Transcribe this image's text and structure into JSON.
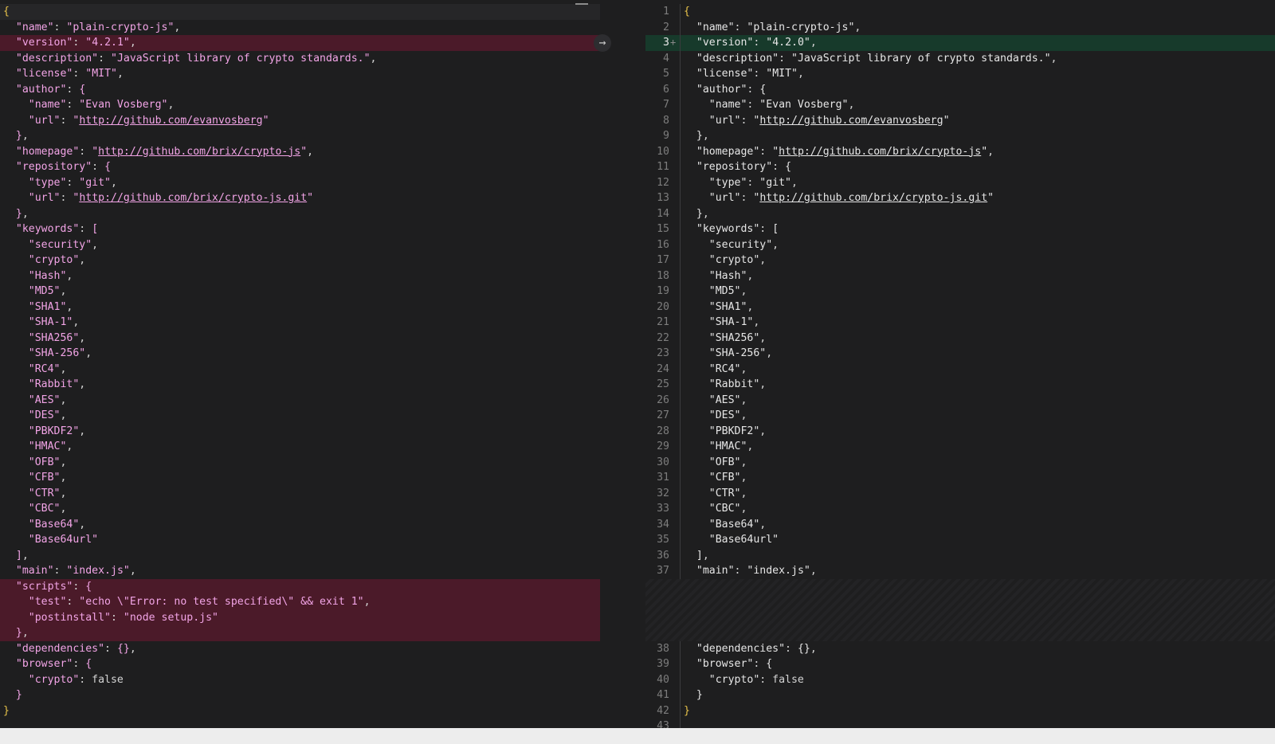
{
  "diff": {
    "left": [
      {
        "text": "{",
        "kind": "first"
      },
      {
        "text": "  \"name\": \"plain-crypto-js\",",
        "kind": "normal"
      },
      {
        "text": "  \"version\": \"4.2.1\",",
        "kind": "removed"
      },
      {
        "text": "  \"description\": \"JavaScript library of crypto standards.\",",
        "kind": "normal"
      },
      {
        "text": "  \"license\": \"MIT\",",
        "kind": "normal"
      },
      {
        "text": "  \"author\": {",
        "kind": "normal"
      },
      {
        "text": "    \"name\": \"Evan Vosberg\",",
        "kind": "normal"
      },
      {
        "text": "    \"url\": \"http://github.com/evanvosberg\"",
        "kind": "normal"
      },
      {
        "text": "  },",
        "kind": "normal"
      },
      {
        "text": "  \"homepage\": \"http://github.com/brix/crypto-js\",",
        "kind": "normal"
      },
      {
        "text": "  \"repository\": {",
        "kind": "normal"
      },
      {
        "text": "    \"type\": \"git\",",
        "kind": "normal"
      },
      {
        "text": "    \"url\": \"http://github.com/brix/crypto-js.git\"",
        "kind": "normal"
      },
      {
        "text": "  },",
        "kind": "normal"
      },
      {
        "text": "  \"keywords\": [",
        "kind": "normal"
      },
      {
        "text": "    \"security\",",
        "kind": "normal"
      },
      {
        "text": "    \"crypto\",",
        "kind": "normal"
      },
      {
        "text": "    \"Hash\",",
        "kind": "normal"
      },
      {
        "text": "    \"MD5\",",
        "kind": "normal"
      },
      {
        "text": "    \"SHA1\",",
        "kind": "normal"
      },
      {
        "text": "    \"SHA-1\",",
        "kind": "normal"
      },
      {
        "text": "    \"SHA256\",",
        "kind": "normal"
      },
      {
        "text": "    \"SHA-256\",",
        "kind": "normal"
      },
      {
        "text": "    \"RC4\",",
        "kind": "normal"
      },
      {
        "text": "    \"Rabbit\",",
        "kind": "normal"
      },
      {
        "text": "    \"AES\",",
        "kind": "normal"
      },
      {
        "text": "    \"DES\",",
        "kind": "normal"
      },
      {
        "text": "    \"PBKDF2\",",
        "kind": "normal"
      },
      {
        "text": "    \"HMAC\",",
        "kind": "normal"
      },
      {
        "text": "    \"OFB\",",
        "kind": "normal"
      },
      {
        "text": "    \"CFB\",",
        "kind": "normal"
      },
      {
        "text": "    \"CTR\",",
        "kind": "normal"
      },
      {
        "text": "    \"CBC\",",
        "kind": "normal"
      },
      {
        "text": "    \"Base64\",",
        "kind": "normal"
      },
      {
        "text": "    \"Base64url\"",
        "kind": "normal"
      },
      {
        "text": "  ],",
        "kind": "normal"
      },
      {
        "text": "  \"main\": \"index.js\",",
        "kind": "normal"
      },
      {
        "text": "  \"scripts\": {",
        "kind": "removed"
      },
      {
        "text": "    \"test\": \"echo \\\"Error: no test specified\\\" && exit 1\",",
        "kind": "removed"
      },
      {
        "text": "    \"postinstall\": \"node setup.js\"",
        "kind": "removed"
      },
      {
        "text": "  },",
        "kind": "removed"
      },
      {
        "text": "  \"dependencies\": {},",
        "kind": "normal"
      },
      {
        "text": "  \"browser\": {",
        "kind": "normal"
      },
      {
        "text": "    \"crypto\": false",
        "kind": "normal"
      },
      {
        "text": "  }",
        "kind": "normal"
      },
      {
        "text": "}",
        "kind": "normal"
      }
    ],
    "right": [
      {
        "ln": "1",
        "text": "{",
        "kind": "normal"
      },
      {
        "ln": "2",
        "text": "  \"name\": \"plain-crypto-js\",",
        "kind": "normal"
      },
      {
        "ln": "3",
        "text": "  \"version\": \"4.2.0\",",
        "kind": "added",
        "marker": "+"
      },
      {
        "ln": "4",
        "text": "  \"description\": \"JavaScript library of crypto standards.\",",
        "kind": "normal"
      },
      {
        "ln": "5",
        "text": "  \"license\": \"MIT\",",
        "kind": "normal"
      },
      {
        "ln": "6",
        "text": "  \"author\": {",
        "kind": "normal"
      },
      {
        "ln": "7",
        "text": "    \"name\": \"Evan Vosberg\",",
        "kind": "normal"
      },
      {
        "ln": "8",
        "text": "    \"url\": \"http://github.com/evanvosberg\"",
        "kind": "normal"
      },
      {
        "ln": "9",
        "text": "  },",
        "kind": "normal"
      },
      {
        "ln": "10",
        "text": "  \"homepage\": \"http://github.com/brix/crypto-js\",",
        "kind": "normal"
      },
      {
        "ln": "11",
        "text": "  \"repository\": {",
        "kind": "normal"
      },
      {
        "ln": "12",
        "text": "    \"type\": \"git\",",
        "kind": "normal"
      },
      {
        "ln": "13",
        "text": "    \"url\": \"http://github.com/brix/crypto-js.git\"",
        "kind": "normal"
      },
      {
        "ln": "14",
        "text": "  },",
        "kind": "normal"
      },
      {
        "ln": "15",
        "text": "  \"keywords\": [",
        "kind": "normal"
      },
      {
        "ln": "16",
        "text": "    \"security\",",
        "kind": "normal"
      },
      {
        "ln": "17",
        "text": "    \"crypto\",",
        "kind": "normal"
      },
      {
        "ln": "18",
        "text": "    \"Hash\",",
        "kind": "normal"
      },
      {
        "ln": "19",
        "text": "    \"MD5\",",
        "kind": "normal"
      },
      {
        "ln": "20",
        "text": "    \"SHA1\",",
        "kind": "normal"
      },
      {
        "ln": "21",
        "text": "    \"SHA-1\",",
        "kind": "normal"
      },
      {
        "ln": "22",
        "text": "    \"SHA256\",",
        "kind": "normal"
      },
      {
        "ln": "23",
        "text": "    \"SHA-256\",",
        "kind": "normal"
      },
      {
        "ln": "24",
        "text": "    \"RC4\",",
        "kind": "normal"
      },
      {
        "ln": "25",
        "text": "    \"Rabbit\",",
        "kind": "normal"
      },
      {
        "ln": "26",
        "text": "    \"AES\",",
        "kind": "normal"
      },
      {
        "ln": "27",
        "text": "    \"DES\",",
        "kind": "normal"
      },
      {
        "ln": "28",
        "text": "    \"PBKDF2\",",
        "kind": "normal"
      },
      {
        "ln": "29",
        "text": "    \"HMAC\",",
        "kind": "normal"
      },
      {
        "ln": "30",
        "text": "    \"OFB\",",
        "kind": "normal"
      },
      {
        "ln": "31",
        "text": "    \"CFB\",",
        "kind": "normal"
      },
      {
        "ln": "32",
        "text": "    \"CTR\",",
        "kind": "normal"
      },
      {
        "ln": "33",
        "text": "    \"CBC\",",
        "kind": "normal"
      },
      {
        "ln": "34",
        "text": "    \"Base64\",",
        "kind": "normal"
      },
      {
        "ln": "35",
        "text": "    \"Base64url\"",
        "kind": "normal"
      },
      {
        "ln": "36",
        "text": "  ],",
        "kind": "normal"
      },
      {
        "ln": "37",
        "text": "  \"main\": \"index.js\",",
        "kind": "normal"
      },
      {
        "kind": "hatch"
      },
      {
        "ln": "38",
        "text": "  \"dependencies\": {},",
        "kind": "normal"
      },
      {
        "ln": "39",
        "text": "  \"browser\": {",
        "kind": "normal"
      },
      {
        "ln": "40",
        "text": "    \"crypto\": false",
        "kind": "normal"
      },
      {
        "ln": "41",
        "text": "  }",
        "kind": "normal"
      },
      {
        "ln": "42",
        "text": "}",
        "kind": "normal"
      },
      {
        "ln": "43",
        "text": "",
        "kind": "normal"
      }
    ],
    "arrow_icon": "arrow-right-icon",
    "arrow_glyph": "→",
    "colors": {
      "removed": "#4b1a29",
      "added": "#173a2b",
      "string": "#f2a4e6",
      "brace": "#e8c34a"
    }
  }
}
